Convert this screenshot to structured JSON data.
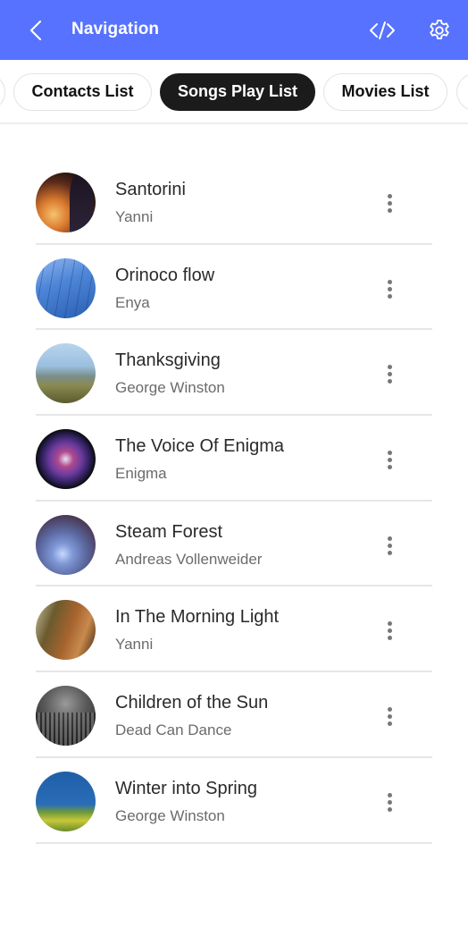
{
  "appbar": {
    "title": "Navigation",
    "back_icon": "chevron-left-icon",
    "code_icon": "code-icon",
    "settings_icon": "gear-icon",
    "background_color": "#5672FE"
  },
  "chips": {
    "items": [
      {
        "label": ""
      },
      {
        "label": "Contacts List"
      },
      {
        "label": "Songs Play List",
        "active": true
      },
      {
        "label": "Movies List"
      },
      {
        "label": ""
      }
    ],
    "active_index": 2
  },
  "songs": [
    {
      "title": "Santorini",
      "artist": "Yanni"
    },
    {
      "title": "Orinoco flow",
      "artist": "Enya"
    },
    {
      "title": "Thanksgiving",
      "artist": "George Winston"
    },
    {
      "title": "The Voice Of Enigma",
      "artist": "Enigma"
    },
    {
      "title": "Steam Forest",
      "artist": "Andreas Vollenweider"
    },
    {
      "title": "In The Morning Light",
      "artist": "Yanni"
    },
    {
      "title": "Children of the Sun",
      "artist": "Dead Can Dance"
    },
    {
      "title": "Winter into Spring",
      "artist": "George Winston"
    }
  ],
  "row_menu_icon": "more-vertical-icon"
}
